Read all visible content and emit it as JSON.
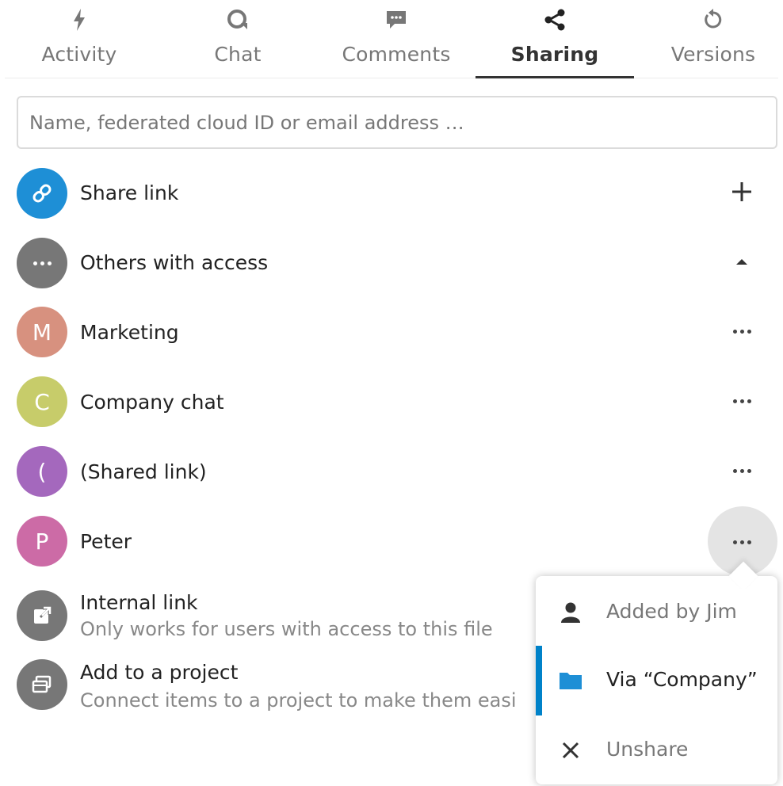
{
  "tabs": [
    {
      "label": "Activity",
      "icon": "activity-icon"
    },
    {
      "label": "Chat",
      "icon": "chat-icon"
    },
    {
      "label": "Comments",
      "icon": "comments-icon"
    },
    {
      "label": "Sharing",
      "icon": "share-icon",
      "active": true
    },
    {
      "label": "Versions",
      "icon": "history-icon"
    }
  ],
  "search": {
    "placeholder": "Name, federated cloud ID or email address …",
    "value": ""
  },
  "share_link": {
    "label": "Share link",
    "icon": "link-icon",
    "action": "add-icon",
    "color": "#1e8fd6"
  },
  "others": {
    "label": "Others with access",
    "icon": "more-icon",
    "action": "caret-up-icon",
    "color": "#777777"
  },
  "shares": [
    {
      "initial": "M",
      "label": "Marketing",
      "color": "#d7917f"
    },
    {
      "initial": "C",
      "label": "Company chat",
      "color": "#c7cc6a"
    },
    {
      "initial": "(",
      "label": "(Shared link)",
      "color": "#a468bd"
    },
    {
      "initial": "P",
      "label": "Peter",
      "color": "#cc6ba6"
    }
  ],
  "internal_link": {
    "label": "Internal link",
    "sub": "Only works for users with access to this file",
    "icon": "external-link-icon"
  },
  "project": {
    "label": "Add to a project",
    "sub": "Connect items to a project to make them easi",
    "icon": "projects-icon"
  },
  "menu": {
    "items": [
      {
        "label": "Added by Jim",
        "icon": "user-icon"
      },
      {
        "label": "Via “Company”",
        "icon": "folder-icon",
        "active": true
      },
      {
        "label": "Unshare",
        "icon": "close-icon"
      }
    ],
    "accent": "#0082c9",
    "folder_color": "#1e8fd6"
  }
}
